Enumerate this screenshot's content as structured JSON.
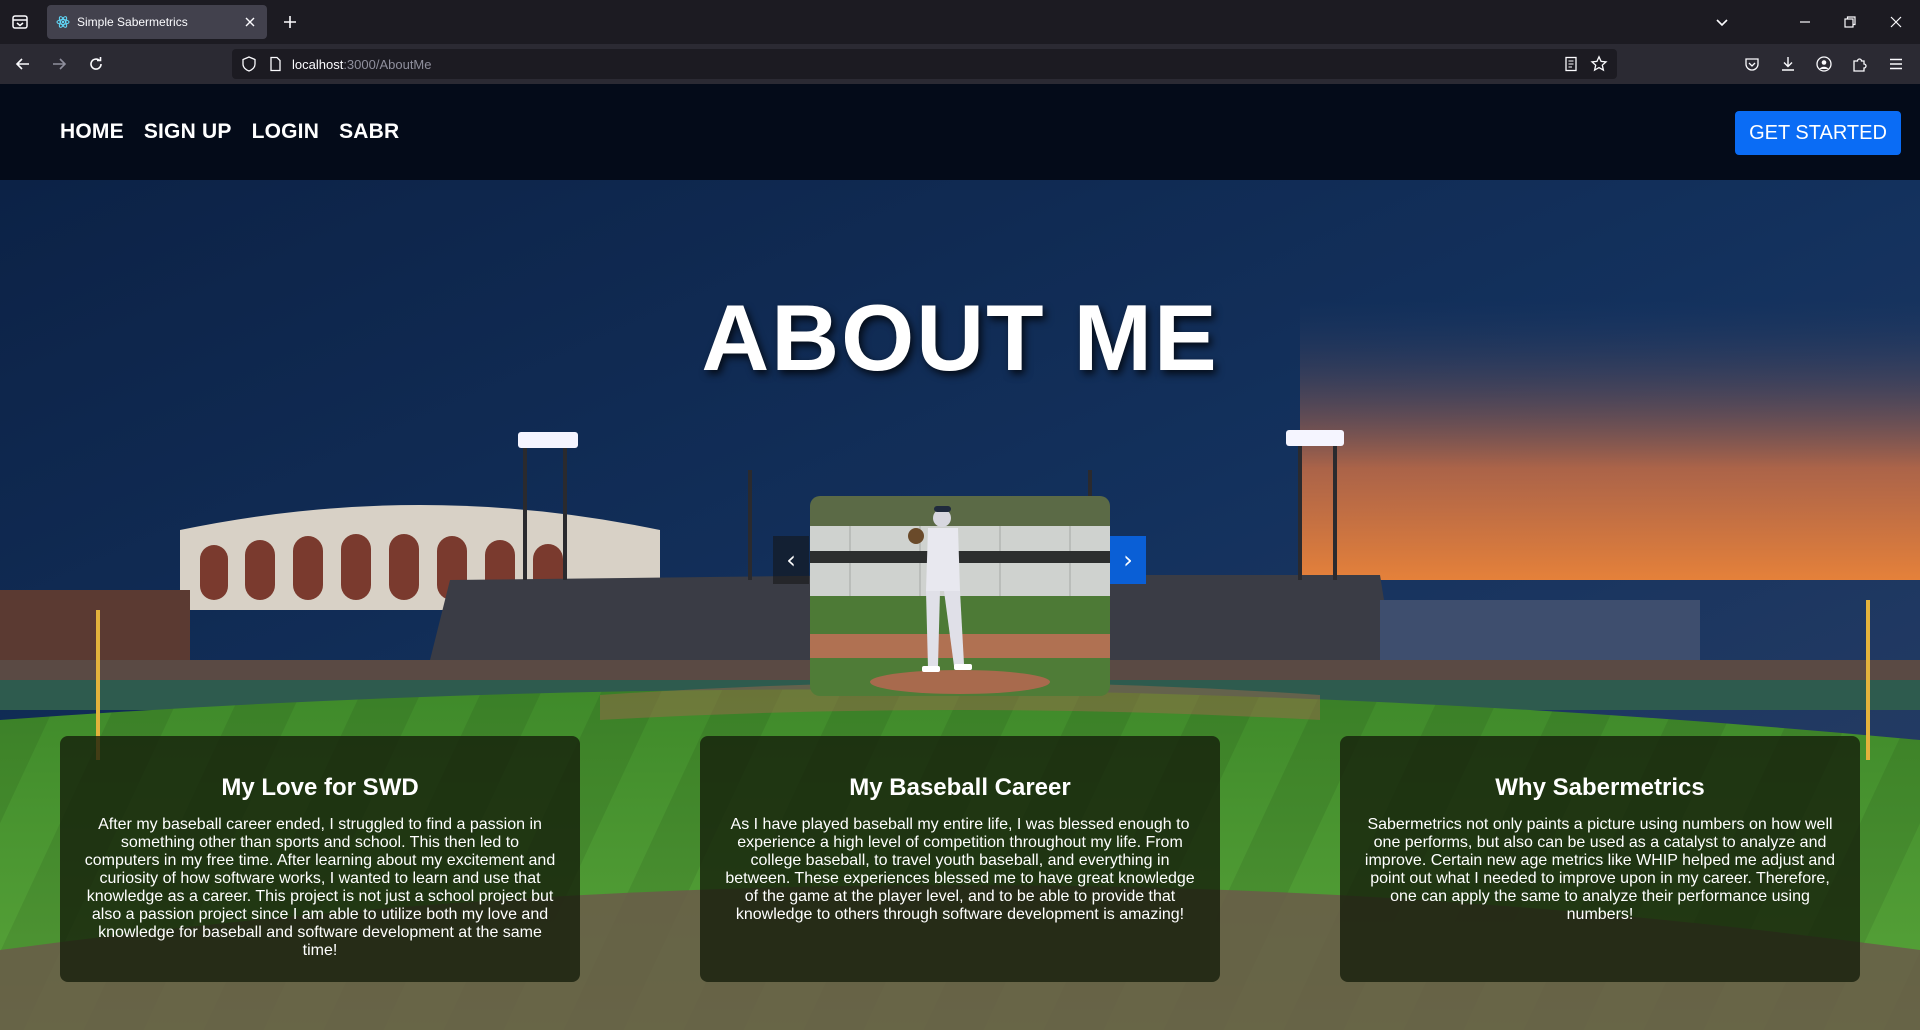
{
  "browser": {
    "tab_title": "Simple Sabermetrics",
    "url_host": "localhost",
    "url_path": ":3000/AboutMe"
  },
  "site": {
    "nav": [
      "HOME",
      "SIGN UP",
      "LOGIN",
      "SABR"
    ],
    "cta_label": "GET STARTED",
    "hero_title": "ABOUT ME",
    "carousel": {
      "prev": "‹",
      "next": "›"
    },
    "cards": [
      {
        "title": "My Love for SWD",
        "body": "After my baseball career ended, I struggled to find a passion in something other than sports and school. This then led to computers in my free time. After learning about my excitement and curiosity of how software works, I wanted to learn and use that knowledge as a career. This project is not just a school project but also a passion project since I am able to utilize both my love and knowledge for baseball and software development at the same time!"
      },
      {
        "title": "My Baseball Career",
        "body": "As I have played baseball my entire life, I was blessed enough to experience a high level of competition throughout my life. From college baseball, to travel youth baseball, and everything in between. These experiences blessed me to have great knowledge of the game at the player level, and to be able to provide that knowledge to others through software development is amazing!"
      },
      {
        "title": "Why Sabermetrics",
        "body": "Sabermetrics not only paints a picture using numbers on how well one performs, but also can be used as a catalyst to analyze and improve. Certain new age metrics like WHIP helped me adjust and point out what I needed to improve upon in my career. Therefore, one can apply the same to analyze their performance using numbers!"
      }
    ]
  },
  "colors": {
    "accent": "#0a6cf5",
    "header_bg": "#040b19",
    "card_bg": "#141c0a"
  }
}
